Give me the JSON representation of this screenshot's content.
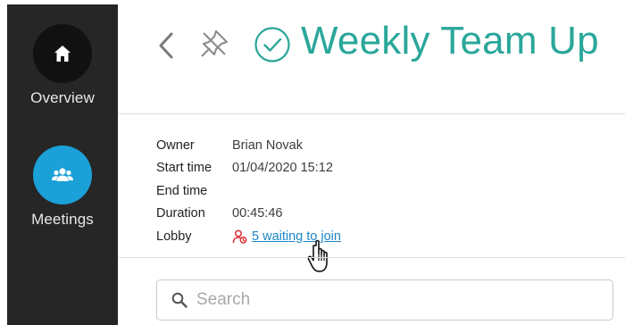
{
  "sidebar": {
    "items": [
      {
        "label": "Overview",
        "icon": "home-icon"
      },
      {
        "label": "Meetings",
        "icon": "people-icon"
      }
    ],
    "active_color": "#1ba0d8"
  },
  "header": {
    "title": "Weekly Team Up",
    "status": "completed",
    "accent_color": "#2aa79a"
  },
  "details": {
    "owner_label": "Owner",
    "owner_value": "Brian Novak",
    "start_label": "Start time",
    "start_value": "01/04/2020 15:12",
    "end_label": "End time",
    "end_value": "",
    "duration_label": "Duration",
    "duration_value": "00:45:46",
    "lobby_label": "Lobby",
    "lobby_value": "5 waiting to join"
  },
  "search": {
    "placeholder": "Search"
  }
}
